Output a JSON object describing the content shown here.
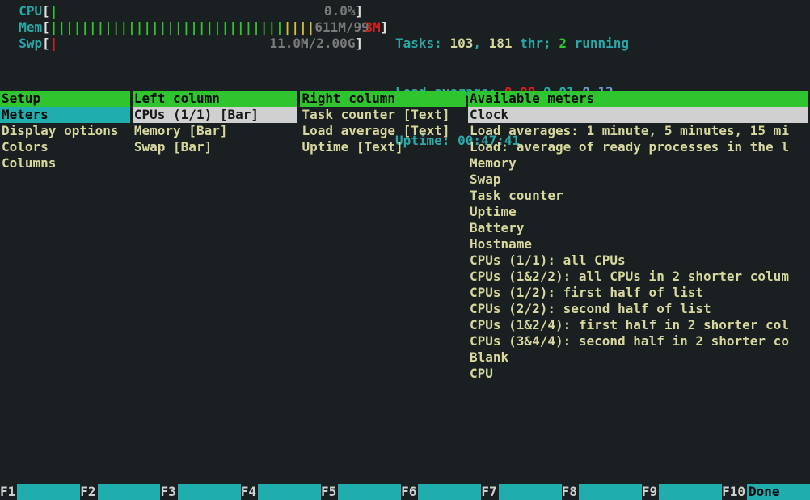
{
  "meters": {
    "cpu": {
      "label": "CPU",
      "bar": "|",
      "value": "0.0%"
    },
    "mem": {
      "label": "Mem",
      "bar_g": "||||||||||||||||||||||||||||||",
      "bar_y": "||||",
      "value": "611M/99",
      "value_tail": "3M"
    },
    "swp": {
      "label": "Swp",
      "bar_r": "|",
      "value": "11.0M/2.00G"
    }
  },
  "stats": {
    "tasks_label": "Tasks: ",
    "tasks_n": "103",
    "tasks_sep": ", ",
    "threads": "181",
    "thr_txt": " thr; ",
    "running": "2",
    "running_txt": " running",
    "load_label": "Load average: ",
    "la1": "0.00",
    "la2": "0.01",
    "la3": "0.12",
    "uptime_label": "Uptime: ",
    "uptime_val": "00:47:41"
  },
  "panels": {
    "setup": {
      "title": "Setup",
      "items": [
        "Meters",
        "Display options",
        "Colors",
        "Columns"
      ],
      "selected": 0
    },
    "leftcol": {
      "title": "Left column",
      "items": [
        "CPUs (1/1) [Bar]",
        "Memory [Bar]",
        "Swap [Bar]"
      ],
      "selected": 0
    },
    "rightcol": {
      "title": "Right column",
      "items": [
        "Task counter [Text]",
        "Load average [Text]",
        "Uptime [Text]"
      ]
    },
    "avail": {
      "title": "Available meters",
      "items": [
        "Clock",
        "Load averages: 1 minute, 5 minutes, 15 mi",
        "Load: average of ready processes in the l",
        "Memory",
        "Swap",
        "Task counter",
        "Uptime",
        "Battery",
        "Hostname",
        "CPUs (1/1): all CPUs",
        "CPUs (1&2/2): all CPUs in 2 shorter colum",
        "CPUs (1/2): first half of list",
        "CPUs (2/2): second half of list",
        "CPUs (1&2/4): first half in 2 shorter col",
        "CPUs (3&4/4): second half in 2 shorter co",
        "Blank",
        "CPU"
      ],
      "selected": 0
    }
  },
  "fkeys": {
    "f1": "F1",
    "f2": "F2",
    "f3": "F3",
    "f4": "F4",
    "f5": "F5",
    "f6": "F6",
    "f7": "F7",
    "f8": "F8",
    "f9": "F9",
    "f10": "F10",
    "f10_label": "Done"
  }
}
